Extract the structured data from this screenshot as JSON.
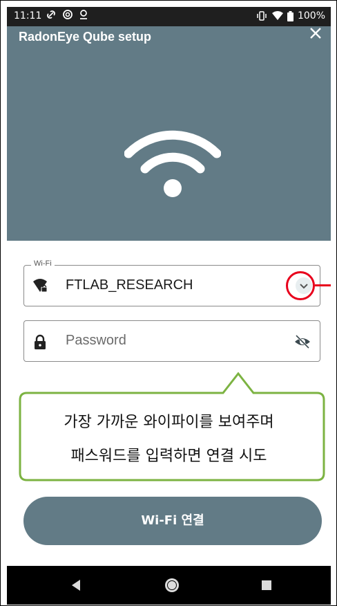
{
  "status_bar": {
    "time": "11:11",
    "battery": "100%",
    "left_icons": [
      "link-icon",
      "sync-icon",
      "location-icon"
    ],
    "right_icons": [
      "vibrate-icon",
      "wifi-signal-icon",
      "battery-icon"
    ]
  },
  "header": {
    "title": "RadonEye Qube setup",
    "close_icon": "close-icon",
    "hero_icon": "wifi-icon"
  },
  "wifi_field": {
    "label": "Wi-Fi",
    "value": "FTLAB_RESEARCH",
    "icon": "wifi-lock-icon",
    "dropdown_icon": "chevron-down-icon"
  },
  "password_field": {
    "placeholder": "Password",
    "icon": "lock-icon",
    "visibility_icon": "eye-off-icon"
  },
  "callout": {
    "line1": "가장 가까운 와이파이를 보여주며",
    "line2": "패스워드를 입력하면 연결 시도"
  },
  "connect_button": {
    "label": "Wi-Fi 연결"
  },
  "nav_bar": {
    "back_icon": "back-triangle-icon",
    "home_icon": "home-circle-icon",
    "recents_icon": "recents-square-icon"
  },
  "colors": {
    "header": "#627b86",
    "callout_border": "#7cb342",
    "marker": "#e8001c"
  }
}
